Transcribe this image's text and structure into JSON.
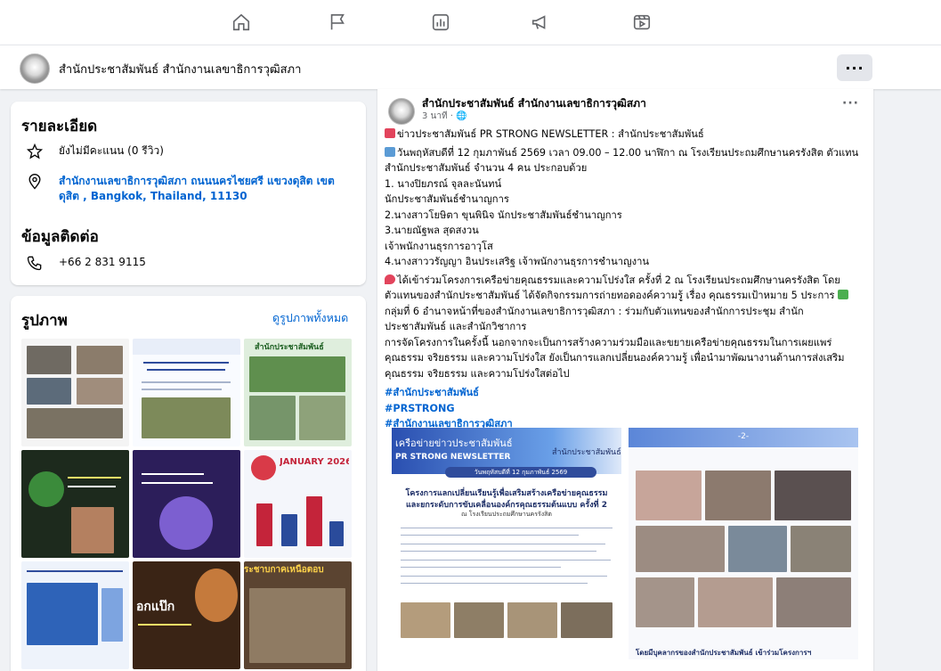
{
  "topnav": {
    "icons": [
      "home-icon",
      "flag-icon",
      "chart-icon",
      "megaphone-icon",
      "video-icon"
    ]
  },
  "page_header": {
    "name": "สำนักประชาสัมพันธ์ สำนักงานเลขาธิการวุฒิสภา",
    "more": "···"
  },
  "details": {
    "title": "รายละเอียด",
    "rating": "ยังไม่มีคะแนน (0 รีวิว)",
    "address_line1": "สำนักงานเลขาธิการวุฒิสภา ถนนนครไชยศรี แขวงดุสิต เขต",
    "address_line2": "ดุสิต , Bangkok, Thailand, 11130",
    "contact_title": "ข้อมูลติดต่อ",
    "phone": "+66 2 831 9115"
  },
  "photos": {
    "title": "รูปภาพ",
    "see_all": "ดูรูปภาพทั้งหมด",
    "thumb_texts": {
      "t3": "สำนักประชาสัมพันธ์",
      "t6": "JANUARY 2026",
      "t7": "อกแป๊ก",
      "t8": "ระชาบกาคเหนือตอบ"
    }
  },
  "post": {
    "author": "สำนักประชาสัมพันธ์ สำนักงานเลขาธิการวุฒิสภา",
    "time": "3 นาที · 🌐",
    "more": "···",
    "lines": [
      "ข่าวประชาสัมพันธ์ PR STRONG NEWSLETTER : สำนักประชาสัมพันธ์",
      "วันพฤหัสบดีที่ 12 กุมภาพันธ์ 2569 เวลา 09.00 – 12.00 นาฬิกา ณ โรงเรียนประถมศึกษานครรังสิต ตัวแทน",
      "สำนักประชาสัมพันธ์ จำนวน 4 คน ประกอบด้วย",
      "1. นางปิยภรณ์ จุลละนันทน์",
      "นักประชาสัมพันธ์ชำนาญการ",
      "2.นางสาวโยษิตา ขุนพินิจ นักประชาสัมพันธ์ชำนาญการ",
      "3.นายณัฐพล สุดสงวน",
      "เจ้าพนักงานธุรการอาวุโส",
      "4.นางสาววรัญญา อินประเสริฐ เจ้าพนักงานธุรการชำนาญงาน",
      "ได้เข้าร่วมโครงการเครือข่ายคุณธรรมและความโปร่งใส ครั้งที่ 2 ณ โรงเรียนประถมศึกษานครรังสิต โดย",
      "ตัวแทนของสำนักประชาสัมพันธ์ ได้จัดกิจกรรมการถ่ายทอดองค์ความรู้ เรื่อง คุณธรรมเป้าหมาย 5 ประการ",
      "กลุ่มที่ 6 อำนาจหน้าที่ของสำนักงานเลขาธิการวุฒิสภา : ร่วมกับตัวแทนของสำนักการประชุม สำนัก",
      "ประชาสัมพันธ์ และสำนักวิชาการ",
      "การจัดโครงการในครั้งนี้ นอกจากจะเป็นการสร้างความร่วมมือและขยายเครือข่ายคุณธรรมในการเผยแพร่",
      "คุณธรรม จริยธรรม และความโปร่งใส ยังเป็นการแลกเปลี่ยนองค์ความรู้ เพื่อนำมาพัฒนางานด้านการส่งเสริม",
      "คุณธรรม จริยธรรม และความโปร่งใสต่อไป"
    ],
    "hashtags": [
      "#สำนักประชาสัมพันธ์",
      "#PRSTRONG",
      "#สำนักงานเลขาธิการวุฒิสภา"
    ],
    "attachment1": {
      "banner": "เครือข่ายข่าวประชาสัมพันธ์",
      "banner_right": "สำนักประชาสัมพันธ์",
      "subtitle": "PR STRONG NEWSLETTER",
      "date": "วันพฤหัสบดีที่ 12 กุมภาพันธ์ 2569",
      "headline1": "โครงการแลกเปลี่ยนเรียนรู้เพื่อเสริมสร้างเครือข่ายคุณธรรม",
      "headline2": "และยกระดับการขับเคลื่อนองค์กรคุณธรรมต้นแบบ ครั้งที่ 2",
      "headline3": "ณ โรงเรียนประถมศึกษานครรังสิต"
    },
    "attachment2": {
      "page_no": "-2-",
      "caption": "โดยมีบุคลากรของสำนักประชาสัมพันธ์ เข้าร่วมโครงการฯ"
    }
  },
  "colors": {
    "link": "#0064d1",
    "background": "#f0f2f5",
    "card": "#ffffff",
    "secondary_text": "#65676b"
  }
}
